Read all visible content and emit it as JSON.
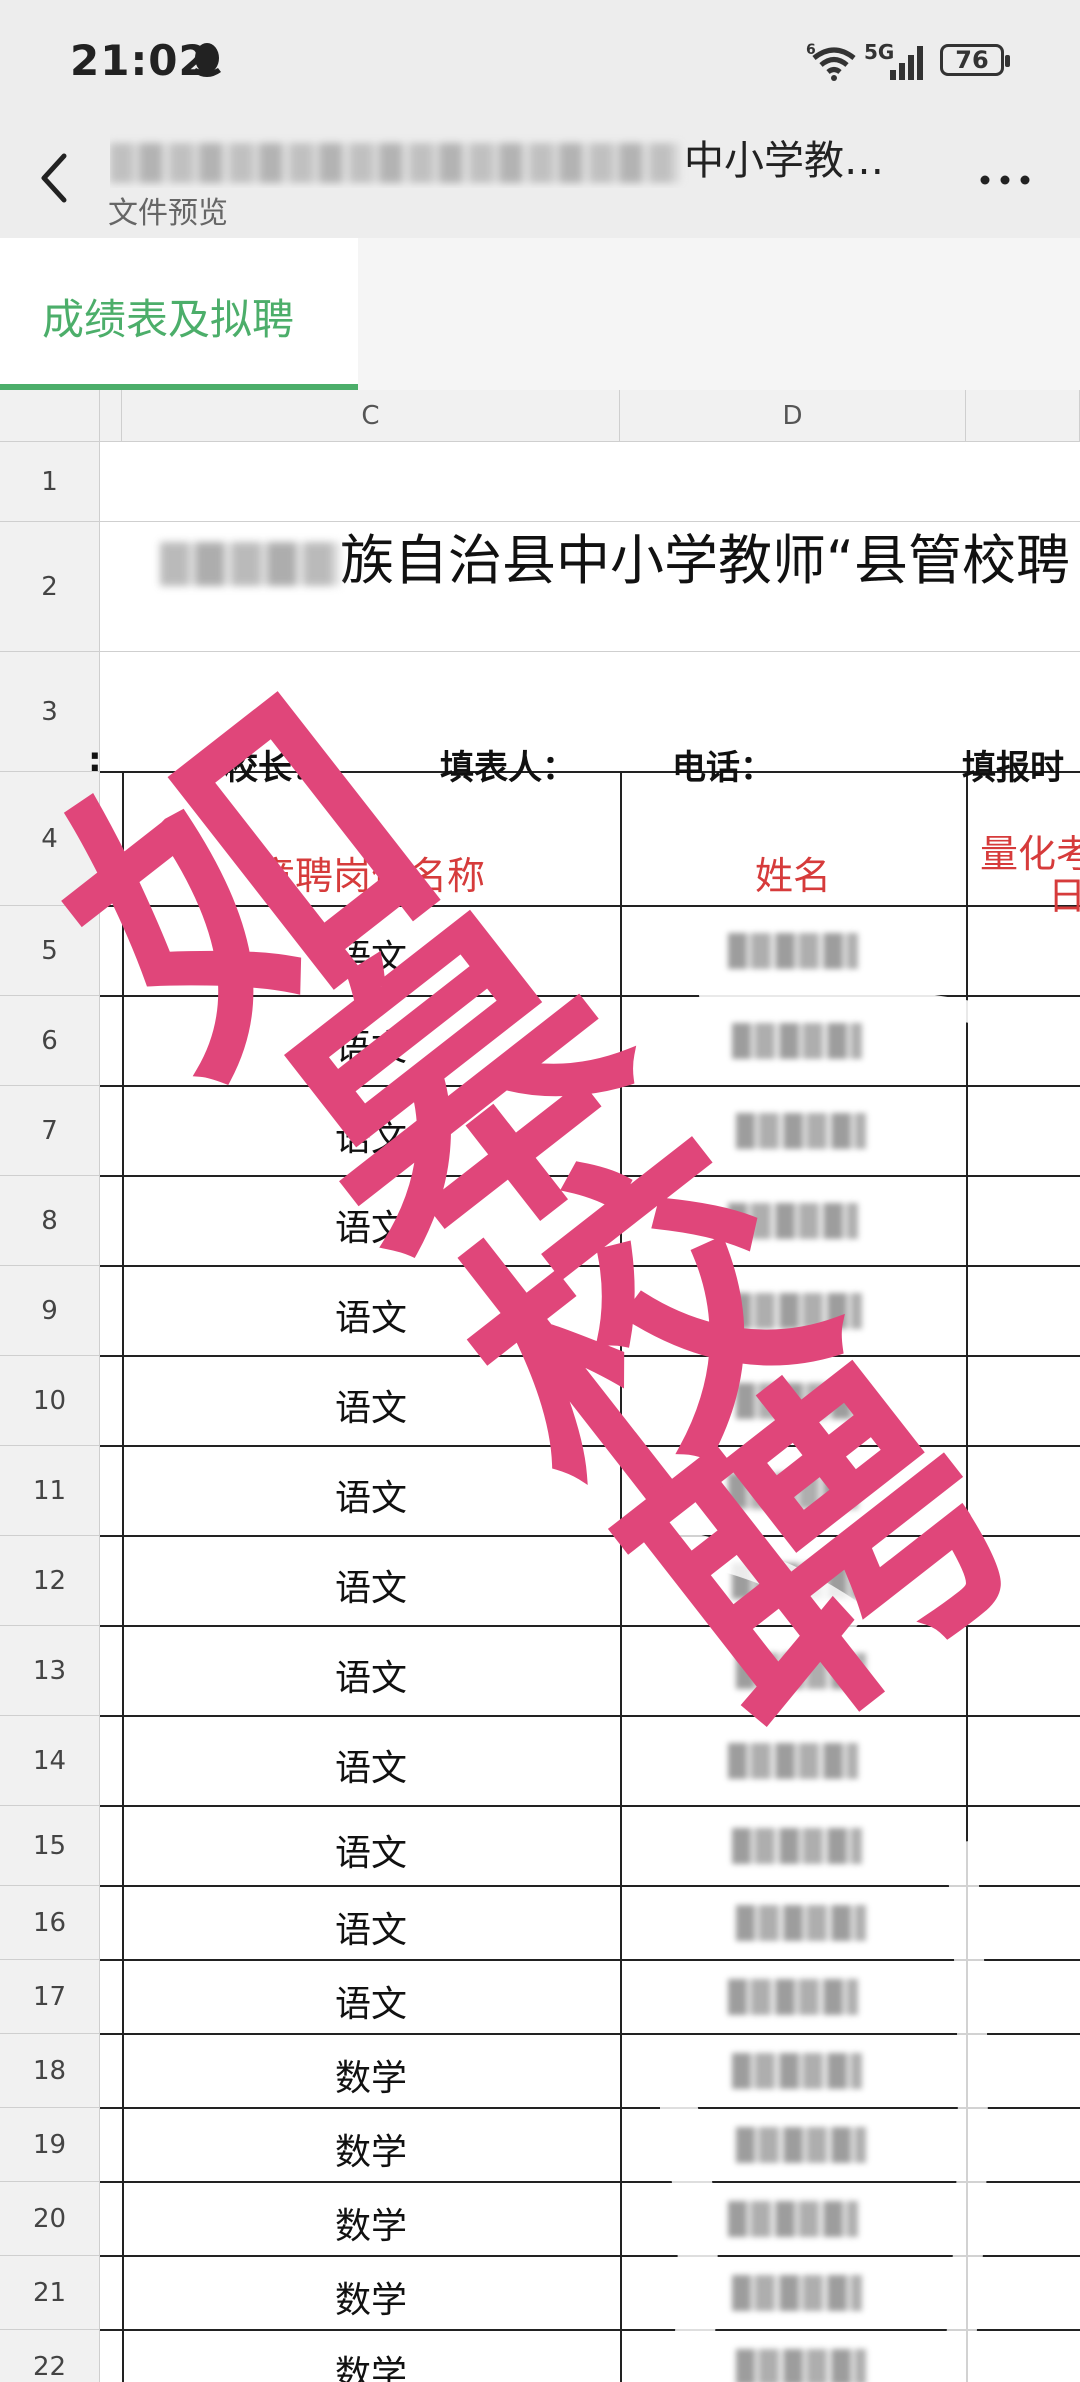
{
  "status_bar": {
    "time": "21:02",
    "network": "5G",
    "battery": "76"
  },
  "nav": {
    "title_visible": "中小学教…",
    "subtitle": "文件预览"
  },
  "sheet_tabs": [
    {
      "label": "成绩表及拟聘",
      "active": true
    }
  ],
  "columns": [
    "C",
    "D"
  ],
  "rows": [
    "1",
    "2",
    "3",
    "4",
    "5",
    "6",
    "7",
    "8",
    "9",
    "10",
    "11",
    "12",
    "13",
    "14",
    "15",
    "16",
    "17",
    "18",
    "19",
    "20",
    "21",
    "22"
  ],
  "sheet": {
    "title_visible": "族自治县中小学教师“县管校聘",
    "info": {
      "principal": "校长：",
      "filler": "填表人：",
      "phone": "电话：",
      "date": "填报时"
    },
    "header": {
      "position": "竞聘岗位名称",
      "name": "姓名",
      "score": "量化考",
      "score2": "日"
    },
    "subjects": [
      "语文",
      "语文",
      "语文",
      "语文",
      "语文",
      "语文",
      "语文",
      "语文",
      "语文",
      "语文",
      "语文",
      "语文",
      "语文",
      "数学",
      "数学",
      "数学",
      "数学",
      "数学"
    ]
  },
  "watermark": {
    "text": "如皋校聘",
    "color": "#e0467a"
  },
  "colors": {
    "accent": "#4cae6a",
    "header_red": "#d63b3b"
  }
}
